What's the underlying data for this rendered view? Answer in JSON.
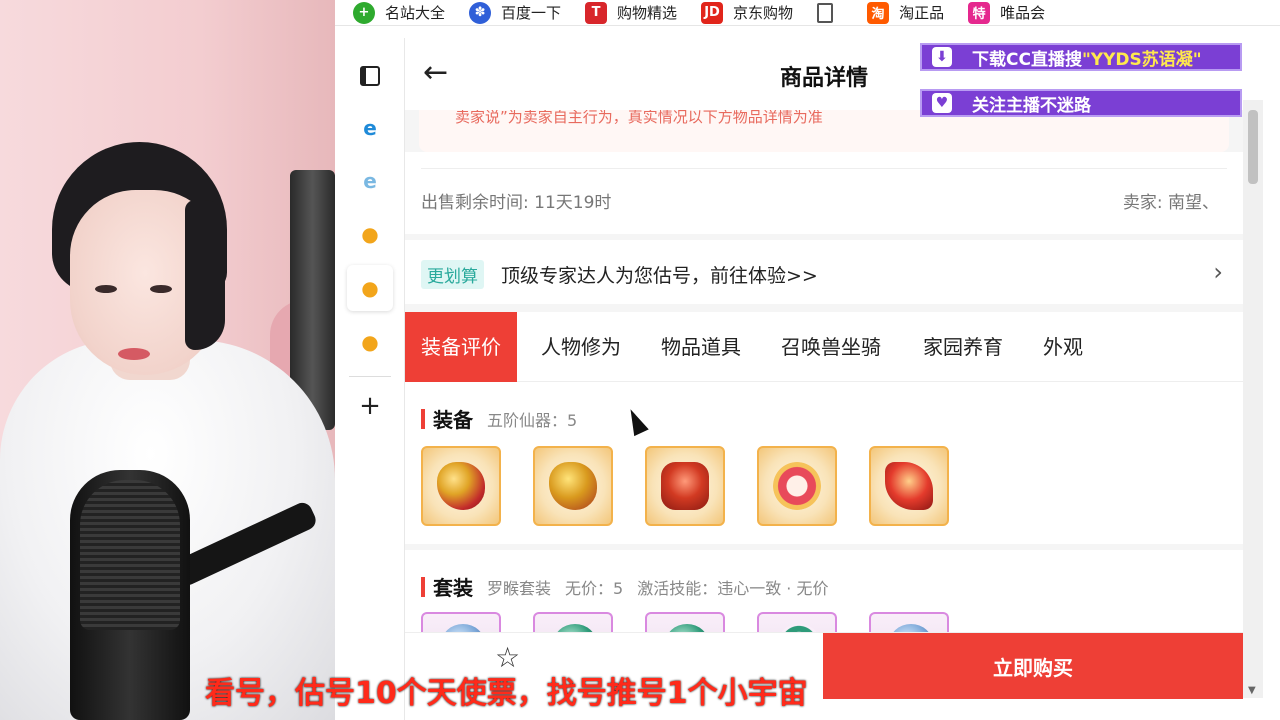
{
  "bookmarks": [
    {
      "label": "名站大全",
      "icon": "plus-circle-icon",
      "color": "#2eaa2e"
    },
    {
      "label": "百度一下",
      "icon": "baidu-paw-icon",
      "color": "#2f5fd8"
    },
    {
      "label": "购物精选",
      "icon": "tmall-icon",
      "color": "#d8262b"
    },
    {
      "label": "京东购物",
      "icon": "jd-icon",
      "color": "#e1251b"
    },
    {
      "label": "",
      "icon": "document-icon",
      "color": "#555555"
    },
    {
      "label": "淘正品",
      "icon": "taobao-icon",
      "color": "#ff5a00"
    },
    {
      "label": "唯品会",
      "icon": "vip-icon",
      "color": "#e5288e"
    }
  ],
  "sidebar": {
    "icons": [
      "tabs-icon",
      "edge-icon",
      "edge-icon",
      "chick-icon",
      "chick-icon",
      "chick-icon",
      "plus-icon"
    ],
    "add_label": "+"
  },
  "header": {
    "back_label": "←",
    "title": "商品详情"
  },
  "notice": {
    "text": "卖家说”为卖家自主行为，真实情况以下方物品详情为准"
  },
  "info": {
    "time_remaining": "出售剩余时间: 11天19时",
    "seller": "卖家: 南望、"
  },
  "promo": {
    "tag": "更划算",
    "text": "顶级专家达人为您估号，前往体验>>",
    "chevron": "›"
  },
  "tabs": [
    {
      "label": "装备评价",
      "active": true
    },
    {
      "label": "人物修为",
      "active": false
    },
    {
      "label": "物品道具",
      "active": false
    },
    {
      "label": "召唤兽坐骑",
      "active": false
    },
    {
      "label": "家园养育",
      "active": false
    },
    {
      "label": "外观",
      "active": false
    }
  ],
  "equipment": {
    "title": "装备",
    "meta": "五阶仙器：5",
    "items": [
      "helmet-item-icon",
      "armor-item-icon",
      "chest-item-icon",
      "bracelet-item-icon",
      "claw-item-icon"
    ]
  },
  "suit": {
    "title": "套装",
    "meta1": "罗睺套装",
    "meta2": "无价：5",
    "meta3": "激活技能：违心一致 · 无价",
    "items": [
      "suit-item-icon",
      "suit-item-icon",
      "suit-item-icon",
      "suit-item-icon",
      "suit-item-icon"
    ]
  },
  "footer": {
    "favorite_icon": "☆",
    "buy_label": "立即购买"
  },
  "overlays": {
    "download_prefix": "下载CC直播搜 ",
    "download_highlight": "\"YYDS苏语凝\"",
    "follow": "关注主播不迷路"
  },
  "caption": "看号，估号10个天使票，找号推号1个小宇宙",
  "colors": {
    "accent": "#ee3f36",
    "overlay": "#7b3fd4",
    "caption": "#ff2a1a"
  }
}
